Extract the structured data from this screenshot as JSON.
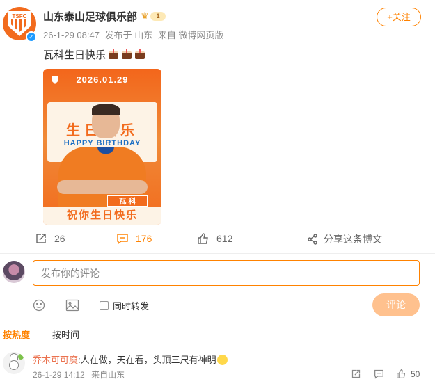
{
  "post": {
    "author": "山东泰山足球俱乐部",
    "avatar_text": "TSFC",
    "vip_level": "1",
    "time": "26-1-29 08:47",
    "location": "发布于 山东",
    "source": "来自 微博网页版",
    "follow_label": "+关注",
    "text": "瓦科生日快乐",
    "image": {
      "date": "2026.01.29",
      "title": "生日快乐",
      "subtitle": "HAPPY BIRTHDAY",
      "player_name": "瓦 科",
      "wish": "祝你生日快乐"
    }
  },
  "actions": {
    "repost_count": "26",
    "comment_count": "176",
    "like_count": "612",
    "share_label": "分享这条博文"
  },
  "composer": {
    "placeholder": "发布你的评论",
    "repost_label": "同时转发",
    "submit_label": "评论"
  },
  "sort_tabs": {
    "hot": "按热度",
    "time": "按时间"
  },
  "comments": [
    {
      "user": "乔木可可庾",
      "text": ":人在做，天在看，头顶三尺有神明",
      "time": "26-1-29 14:12",
      "location": "来自山东",
      "like_count": "50"
    }
  ],
  "colors": {
    "accent": "#ff8200",
    "username": "#eb7350",
    "submit_disabled": "#ffc18e"
  }
}
